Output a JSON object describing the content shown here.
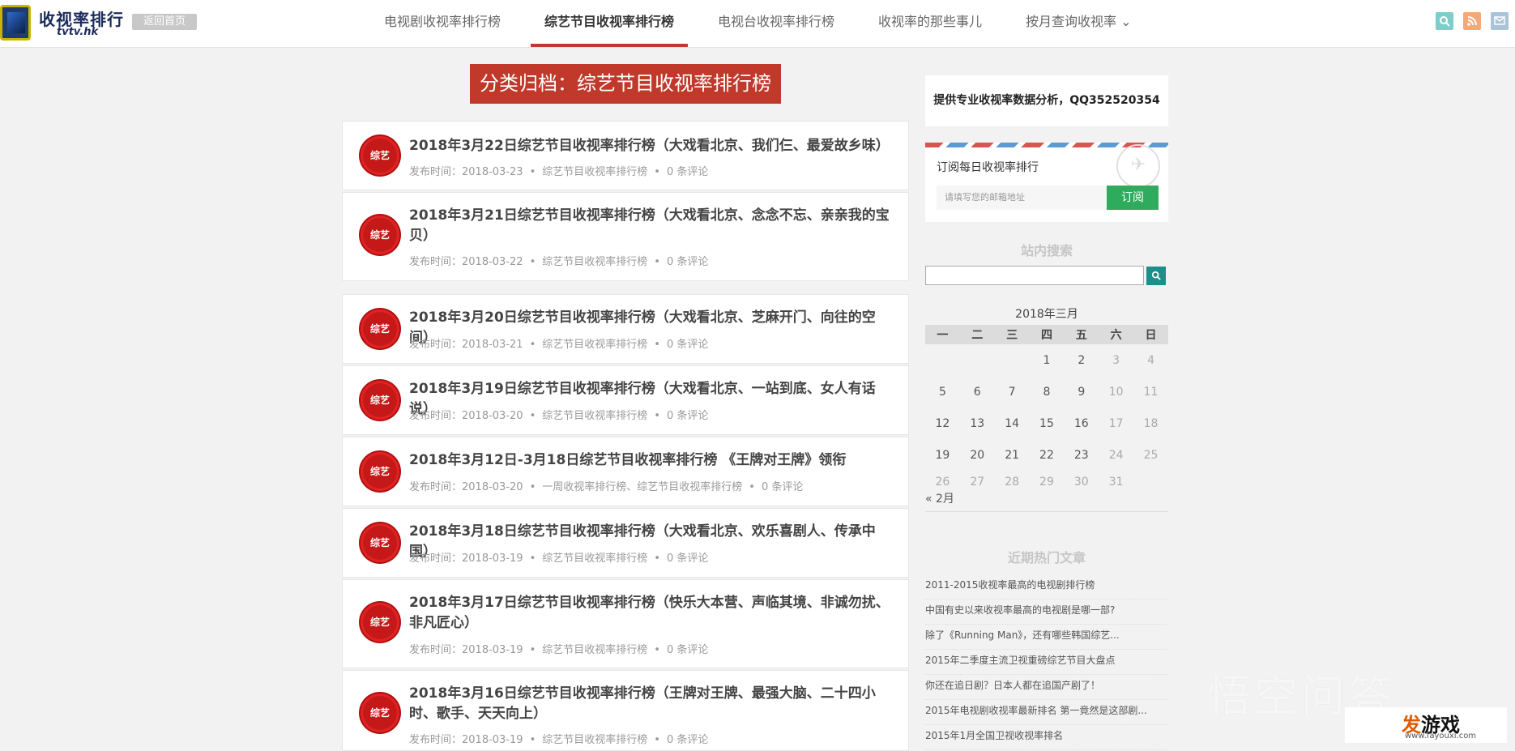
{
  "header": {
    "logo_text": "收视率排行",
    "logo_sub": "tvtv.hk",
    "home_button": "返回首页",
    "nav": [
      {
        "label": "电视剧收视率排行榜",
        "active": false
      },
      {
        "label": "综艺节目收视率排行榜",
        "active": true
      },
      {
        "label": "电视台收视率排行榜",
        "active": false
      },
      {
        "label": "收视率的那些事儿",
        "active": false
      },
      {
        "label": "按月查询收视率 ⌄",
        "active": false
      }
    ],
    "icons": {
      "search": "search-icon",
      "rss": "rss-icon",
      "mail": "mail-icon"
    },
    "colors": {
      "accent": "#c0392b",
      "search": "#7ecdc8",
      "rss": "#f3a97a",
      "mail": "#a9c3d9"
    }
  },
  "category_title": "分类归档：综艺节目收视率排行榜",
  "posts": [
    {
      "badge": "综艺",
      "title": "2018年3月22日综艺节目收视率排行榜（大戏看北京、我们仨、最爱故乡味）",
      "meta_label": "发布时间：",
      "date": "2018-03-23",
      "categories": "综艺节目收视率排行榜",
      "comments": "0 条评论"
    },
    {
      "badge": "综艺",
      "title": "2018年3月21日综艺节目收视率排行榜（大戏看北京、念念不忘、亲亲我的宝贝）",
      "meta_label": "发布时间：",
      "date": "2018-03-22",
      "categories": "综艺节目收视率排行榜",
      "comments": "0 条评论"
    },
    {
      "badge": "综艺",
      "title": "2018年3月20日综艺节目收视率排行榜（大戏看北京、芝麻开门、向往的空间）",
      "meta_label": "发布时间：",
      "date": "2018-03-21",
      "categories": "综艺节目收视率排行榜",
      "comments": "0 条评论"
    },
    {
      "badge": "综艺",
      "title": "2018年3月19日综艺节目收视率排行榜（大戏看北京、一站到底、女人有话说）",
      "meta_label": "发布时间：",
      "date": "2018-03-20",
      "categories": "综艺节目收视率排行榜",
      "comments": "0 条评论"
    },
    {
      "badge": "综艺",
      "title": "2018年3月12日-3月18日综艺节目收视率排行榜 《王牌对王牌》领衔",
      "meta_label": "发布时间：",
      "date": "2018-03-20",
      "categories": "一周收视率排行榜、综艺节目收视率排行榜",
      "comments": "0 条评论"
    },
    {
      "badge": "综艺",
      "title": "2018年3月18日综艺节目收视率排行榜（大戏看北京、欢乐喜剧人、传承中国）",
      "meta_label": "发布时间：",
      "date": "2018-03-19",
      "categories": "综艺节目收视率排行榜",
      "comments": "0 条评论"
    },
    {
      "badge": "综艺",
      "title": "2018年3月17日综艺节目收视率排行榜（快乐大本营、声临其境、非诚勿扰、非凡匠心）",
      "meta_label": "发布时间：",
      "date": "2018-03-19",
      "categories": "综艺节目收视率排行榜",
      "comments": "0 条评论"
    },
    {
      "badge": "综艺",
      "title": "2018年3月16日综艺节目收视率排行榜（王牌对王牌、最强大脑、二十四小时、歌手、天天向上）",
      "meta_label": "发布时间：",
      "date": "2018-03-19",
      "categories": "综艺节目收视率排行榜",
      "comments": "0 条评论"
    }
  ],
  "sidebar": {
    "contact": "提供专业收视率数据分析，QQ352520354",
    "subscribe": {
      "title": "订阅每日收视率排行",
      "placeholder": "请填写您的邮箱地址",
      "button": "订阅"
    },
    "search_title": "站内搜索",
    "calendar": {
      "caption": "2018年三月",
      "weekdays": [
        "一",
        "二",
        "三",
        "四",
        "五",
        "六",
        "日"
      ],
      "weeks": [
        [
          "",
          "",
          "",
          "1",
          "2",
          "3",
          "4"
        ],
        [
          "5",
          "6",
          "7",
          "8",
          "9",
          "10",
          "11"
        ],
        [
          "12",
          "13",
          "14",
          "15",
          "16",
          "17",
          "18"
        ],
        [
          "19",
          "20",
          "21",
          "22",
          "23",
          "24",
          "25"
        ],
        [
          "26",
          "27",
          "28",
          "29",
          "30",
          "31",
          ""
        ]
      ],
      "prev": "« 2月"
    },
    "hot_title": "近期热门文章",
    "hot_posts": [
      "2011-2015收视率最高的电视剧排行榜",
      "中国有史以来收视率最高的电视剧是哪一部?",
      "除了《Running Man》，还有哪些韩国综艺...",
      "2015年二季度主流卫视重磅综艺节目大盘点",
      "你还在追日剧？日本人都在追国产剧了！",
      "2015年电视剧收视率最新排名 第一竟然是这部剧...",
      "2015年1月全国卫视收视率排名"
    ]
  },
  "watermark": "悟空问答",
  "site_logo": {
    "main_a": "发",
    "main_b": "游戏",
    "url": "www.fayouxi.com"
  }
}
